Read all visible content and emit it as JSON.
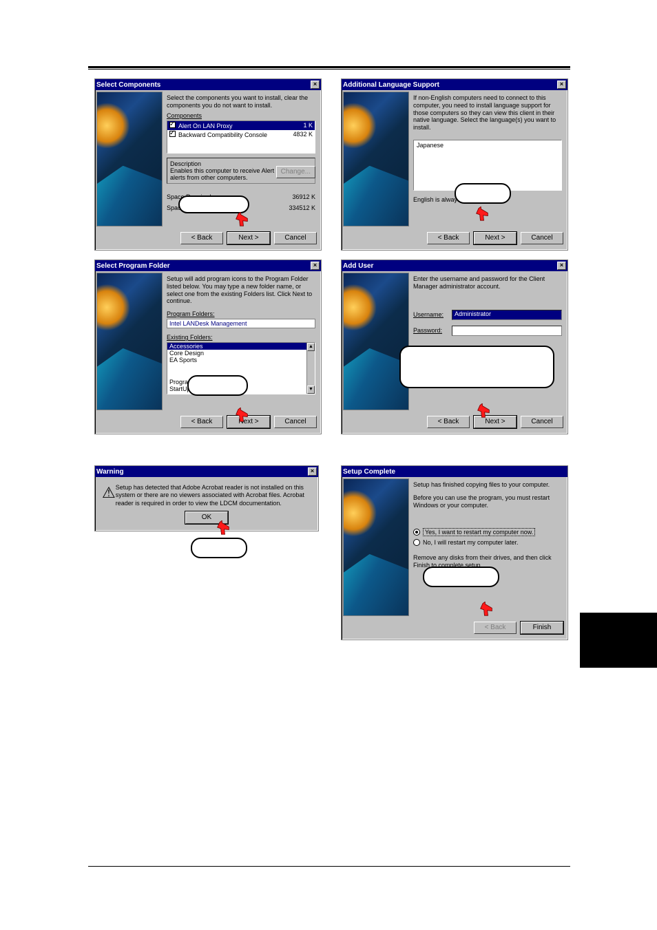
{
  "dialogs": {
    "select_components": {
      "title": "Select Components",
      "instruction": "Select the components you want to install, clear the components you do not want to install.",
      "components_label": "Components",
      "items": [
        {
          "label": "Alert On LAN Proxy",
          "size": "1 K",
          "checked": true,
          "selected": true
        },
        {
          "label": "Backward Compatibility Console",
          "size": "4832 K",
          "checked": true,
          "selected": false
        }
      ],
      "description_label": "Description",
      "description_text": "Enables this computer to receive Alert on LAN alerts from other computers.",
      "change_btn": "Change...",
      "space_required_label": "Space Required:",
      "space_required": "36912 K",
      "space_available_label": "Space Available:",
      "space_available": "334512 K",
      "back": "< Back",
      "next": "Next >",
      "cancel": "Cancel"
    },
    "language": {
      "title": "Additional Language Support",
      "instruction": "If non-English computers need to connect to this computer, you need to install language support for those computers so they can view this client in their native language. Select the language(s) you want to install.",
      "item": "Japanese",
      "note": "English is always installed.",
      "back": "< Back",
      "next": "Next >",
      "cancel": "Cancel"
    },
    "program_folder": {
      "title": "Select Program Folder",
      "instruction": "Setup will add program icons to the Program Folder listed below. You may type a new folder name, or select one from the existing Folders list.  Click Next to continue.",
      "program_folders_label": "Program Folders:",
      "folder_value": "Intel LANDesk Management",
      "existing_label": "Existing Folders:",
      "existing": [
        "Accessories",
        "Core Design",
        "EA Sports",
        "",
        "",
        "Programs",
        "StartUp"
      ],
      "back": "< Back",
      "next": "Next >",
      "cancel": "Cancel"
    },
    "add_user": {
      "title": "Add User",
      "instruction": "Enter the username and password for the Client Manager administrator account.",
      "username_label": "Username:",
      "username_value": "Administrator",
      "password_label": "Password:",
      "password_value": "",
      "back": "< Back",
      "next": "Next >",
      "cancel": "Cancel"
    },
    "warning": {
      "title": "Warning",
      "text": "Setup has detected that Adobe Acrobat reader is not installed on this system or there are no viewers associated with Acrobat files. Acrobat reader is required in order to view the LDCM documentation.",
      "ok": "OK"
    },
    "complete": {
      "title": "Setup Complete",
      "line1": "Setup has finished copying files to your computer.",
      "line2": "Before you can use the program, you must restart Windows or your computer.",
      "opt1": "Yes, I want to restart my computer now.",
      "opt2": "No, I will restart my computer later.",
      "tail": "Remove any disks from their drives, and then click Finish to complete setup.",
      "back": "< Back",
      "finish": "Finish"
    }
  }
}
